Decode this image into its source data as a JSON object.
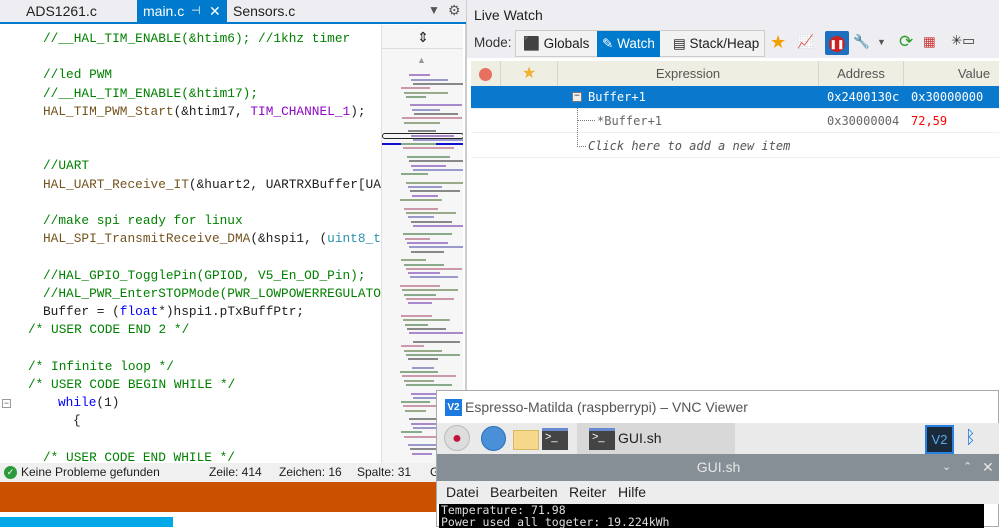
{
  "editor": {
    "tabs": [
      {
        "label": "ADS1261.c"
      },
      {
        "label": "main.c",
        "active": true
      },
      {
        "label": "Sensors.c"
      }
    ],
    "code_lines": [
      {
        "text": "//__HAL_TIM_ENABLE(&htim6); //1khz timer",
        "indent": 43,
        "kind": "cm"
      },
      {
        "text": "",
        "indent": 43
      },
      {
        "text": "//led PWM",
        "indent": 43,
        "kind": "cm"
      },
      {
        "text": "//__HAL_TIM_ENABLE(&htim17);",
        "indent": 43,
        "kind": "cm"
      },
      {
        "parts": [
          [
            "fn",
            "HAL_TIM_PWM_Start"
          ],
          [
            "",
            "(&htim17, "
          ],
          [
            "mac",
            "TIM_CHANNEL_1"
          ],
          [
            "",
            ");"
          ]
        ],
        "indent": 43
      },
      {
        "text": "",
        "indent": 43
      },
      {
        "text": "",
        "indent": 43
      },
      {
        "text": "//UART",
        "indent": 43,
        "kind": "cm"
      },
      {
        "parts": [
          [
            "fn",
            "HAL_UART_Receive_IT"
          ],
          [
            "",
            "(&huart2, UARTRXBuffer[UA"
          ]
        ],
        "indent": 43
      },
      {
        "text": "",
        "indent": 43
      },
      {
        "text": "//make spi ready for linux",
        "indent": 43,
        "kind": "cm"
      },
      {
        "parts": [
          [
            "fn",
            "HAL_SPI_TransmitReceive_DMA"
          ],
          [
            "",
            "(&hspi1, ("
          ],
          [
            "ty",
            "uint8_t"
          ]
        ],
        "indent": 43
      },
      {
        "text": "",
        "indent": 43
      },
      {
        "text": "//HAL_GPIO_TogglePin(GPIOD, V5_En_OD_Pin);",
        "indent": 43,
        "kind": "cm"
      },
      {
        "text": "//HAL_PWR_EnterSTOPMode(PWR_LOWPOWERREGULATO",
        "indent": 43,
        "kind": "cm"
      },
      {
        "parts": [
          [
            "",
            "Buffer = ("
          ],
          [
            "kw",
            "float"
          ],
          [
            "",
            "*)hspi1.pTxBuffPtr;"
          ]
        ],
        "indent": 43
      },
      {
        "text": "/* USER CODE END 2 */",
        "indent": 28,
        "kind": "cm"
      },
      {
        "text": "",
        "indent": 28
      },
      {
        "text": "/* Infinite loop */",
        "indent": 28,
        "kind": "cm"
      },
      {
        "text": "/* USER CODE BEGIN WHILE */",
        "indent": 28,
        "kind": "cm"
      },
      {
        "parts": [
          [
            "kw",
            "while"
          ],
          [
            "",
            "(1)"
          ]
        ],
        "indent": 58
      },
      {
        "text": "{",
        "indent": 73
      },
      {
        "text": "",
        "indent": 43
      },
      {
        "text": "/* USER CODE END WHILE */",
        "indent": 43,
        "kind": "cm"
      }
    ],
    "status": {
      "problems": "Keine Probleme gefunden",
      "line": "Zeile: 414",
      "char": "Zeichen: 16",
      "col": "Spalte: 31",
      "extra": "G"
    }
  },
  "watch": {
    "title": "Live Watch",
    "mode_label": "Mode:",
    "modes": [
      {
        "label": "Globals"
      },
      {
        "label": "Watch",
        "active": true
      },
      {
        "label": "Stack/Heap"
      }
    ],
    "columns": {
      "expression": "Expression",
      "address": "Address",
      "value": "Value"
    },
    "rows": [
      {
        "expression": "Buffer+1",
        "address": "0x2400130c",
        "value": "0x30000000",
        "selected": true
      },
      {
        "expression": "*Buffer+1",
        "address": "0x30000004",
        "value": "72,59",
        "value_color": "#ff0000"
      }
    ],
    "add_item": "Click here to add a new item"
  },
  "vnc": {
    "title": "Espresso-Matilda (raspberrypi) – VNC Viewer",
    "task_label": "GUI.sh",
    "window_title": "GUI.sh",
    "menu": [
      "Datei",
      "Bearbeiten",
      "Reiter",
      "Hilfe"
    ],
    "terminal": [
      "Temperature: 71.98",
      "Power used all togeter: 19.224kWh"
    ]
  },
  "colors": {
    "accent": "#007acc",
    "orange": "#ca5100"
  }
}
